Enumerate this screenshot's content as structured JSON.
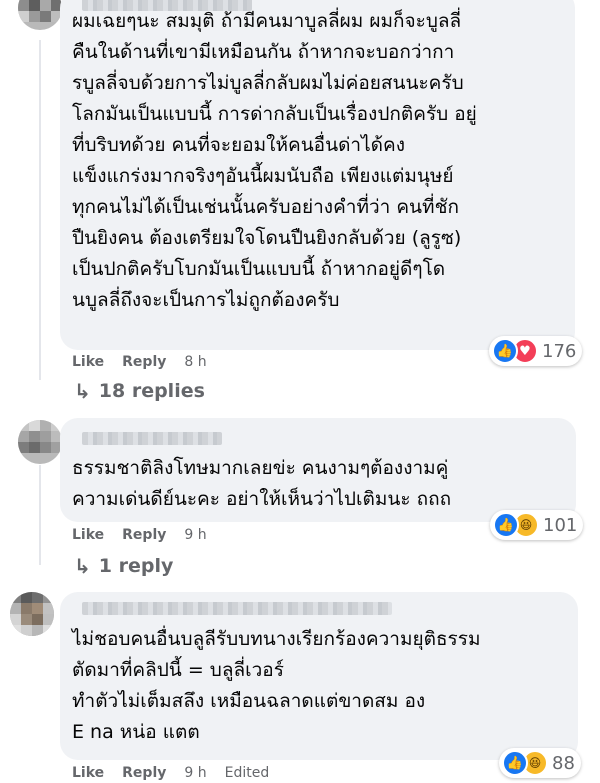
{
  "comments": [
    {
      "text": "ผมเฉยๆนะ สมมุติ ถ้ามีคนมาบูลลี่ผม ผมก็จะบูลลี่\nคืนในด้านที่เขามีเหมือนกัน ถ้าหากจะบอกว่ากา\nรบูลลี่จบด้วยการไม่บูลลี่กลับผมไม่ค่อยสนนะครับ\nโลกมันเป็นแบบนี้ การด่ากลับเป็นเรื่องปกติครับ อยู่\nที่บริบทด้วย คนที่จะยอมให้คนอื่นด่าได้คง\nแข็งแกร่งมากจริงๆอันนี้ผมนับถือ เพียงแต่มนุษย์\nทุกคนไม่ได้เป็นเช่นนั้นครับอย่างคำที่ว่า คนที่ชัก\nปืนยิงคน ต้องเตรียมใจโดนปืนยิงกลับด้วย (ลูรูซ)\nเป็นปกติครับโบกมันเป็นแบบนี้ ถ้าหากอยู่ดีๆโด\nนบูลลี่ถึงจะเป็นการไม่ถูกต้องครับ",
      "like_label": "Like",
      "reply_label": "Reply",
      "time": "8 h",
      "reaction_count": "176",
      "reactions": [
        "like",
        "love"
      ],
      "replies_label": "18 replies"
    },
    {
      "text": "ธรรมชาติลิงโทษมากเลยข่ะ คนงามๆต้องงามคู่\nความเด่นดีย์นะคะ อย่าให้เห็นว่าไปเติมนะ ถถถ",
      "like_label": "Like",
      "reply_label": "Reply",
      "time": "9 h",
      "reaction_count": "101",
      "reactions": [
        "like",
        "haha"
      ],
      "replies_label": "1 reply"
    },
    {
      "text": "ไม่ชอบคนอื่นบลูลีรับบทนางเรียกร้องความยุติธรรม\nตัดมาที่คลิปนี้ = บลูลี่เวอร์\nทำตัวไม่เต็มสลึง เหมือนฉลาดแต่ขาดสม อง\nE na หน่อ แตต",
      "like_label": "Like",
      "reply_label": "Reply",
      "time": "9 h",
      "edited_label": "Edited",
      "reaction_count": "88",
      "reactions": [
        "like",
        "haha"
      ]
    }
  ],
  "icons": {
    "reply_arrow": "↳",
    "like": "👍",
    "love": "♥",
    "haha": "😆"
  },
  "colors": {
    "bubble": "#f0f2f5",
    "meta": "#65676b",
    "like": "#1877f2",
    "love": "#f33e58",
    "haha": "#f7b928"
  }
}
